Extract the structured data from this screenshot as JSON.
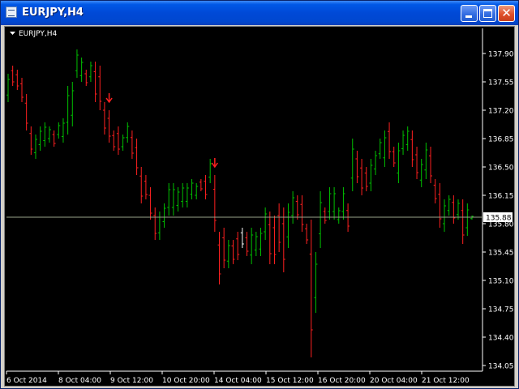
{
  "window": {
    "title": "EURJPY,H4",
    "minimize_glyph": "minimize-icon",
    "maximize_glyph": "maximize-icon",
    "close_glyph": "✕"
  },
  "chart_label": "EURJPY,H4",
  "current_price_label": "135.88",
  "colors": {
    "background": "#000000",
    "axis": "#ffffff",
    "bull": "#00c000",
    "bear": "#ff2020",
    "current_price_line": "#9aa58a",
    "current_price_box": "#ffffff",
    "arrow": "#ff2020",
    "last_bar": "#ffffff"
  },
  "chart_data": {
    "type": "ohlc-bar",
    "symbol": "EURJPY",
    "timeframe": "H4",
    "title": "EURJPY,H4",
    "ylim": [
      134.0,
      138.15
    ],
    "y_ticks": [
      "137.90",
      "137.55",
      "137.20",
      "136.85",
      "136.50",
      "136.15",
      "135.80",
      "135.45",
      "135.10",
      "134.75",
      "134.40",
      "134.05"
    ],
    "x_ticks": [
      "6 Oct 2014",
      "8 Oct 04:00",
      "9 Oct 12:00",
      "10 Oct 20:00",
      "14 Oct 04:00",
      "15 Oct 12:00",
      "16 Oct 20:00",
      "20 Oct 04:00",
      "21 Oct 12:00"
    ],
    "current_price": 135.88,
    "arrows": [
      {
        "bar_index": 22,
        "direction": "down"
      },
      {
        "bar_index": 45,
        "direction": "down"
      }
    ],
    "bars": [
      {
        "high": 137.65,
        "low": 137.3,
        "close_dir": "up"
      },
      {
        "high": 137.75,
        "low": 137.5,
        "close_dir": "down"
      },
      {
        "high": 137.7,
        "low": 137.45,
        "close_dir": "down"
      },
      {
        "high": 137.6,
        "low": 137.3,
        "close_dir": "down"
      },
      {
        "high": 137.4,
        "low": 136.95,
        "close_dir": "down"
      },
      {
        "high": 137.0,
        "low": 136.65,
        "close_dir": "down"
      },
      {
        "high": 136.9,
        "low": 136.6,
        "close_dir": "up"
      },
      {
        "high": 137.0,
        "low": 136.7,
        "close_dir": "up"
      },
      {
        "high": 137.05,
        "low": 136.75,
        "close_dir": "up"
      },
      {
        "high": 137.0,
        "low": 136.8,
        "close_dir": "up"
      },
      {
        "high": 136.95,
        "low": 136.75,
        "close_dir": "down"
      },
      {
        "high": 137.05,
        "low": 136.85,
        "close_dir": "up"
      },
      {
        "high": 137.1,
        "low": 136.8,
        "close_dir": "up"
      },
      {
        "high": 137.5,
        "low": 136.9,
        "close_dir": "up"
      },
      {
        "high": 137.55,
        "low": 137.0,
        "close_dir": "up"
      },
      {
        "high": 137.95,
        "low": 137.6,
        "close_dir": "up"
      },
      {
        "high": 137.85,
        "low": 137.55,
        "close_dir": "up"
      },
      {
        "high": 137.7,
        "low": 137.5,
        "close_dir": "down"
      },
      {
        "high": 137.8,
        "low": 137.55,
        "close_dir": "up"
      },
      {
        "high": 137.8,
        "low": 137.3,
        "close_dir": "down"
      },
      {
        "high": 137.75,
        "low": 137.2,
        "close_dir": "down"
      },
      {
        "high": 137.3,
        "low": 136.9,
        "close_dir": "down"
      },
      {
        "high": 137.2,
        "low": 136.8,
        "close_dir": "down"
      },
      {
        "high": 136.95,
        "low": 136.7,
        "close_dir": "down"
      },
      {
        "high": 137.0,
        "low": 136.65,
        "close_dir": "down"
      },
      {
        "high": 136.9,
        "low": 136.7,
        "close_dir": "up"
      },
      {
        "high": 137.05,
        "low": 136.8,
        "close_dir": "up"
      },
      {
        "high": 136.95,
        "low": 136.6,
        "close_dir": "down"
      },
      {
        "high": 136.85,
        "low": 136.4,
        "close_dir": "down"
      },
      {
        "high": 136.5,
        "low": 136.05,
        "close_dir": "down"
      },
      {
        "high": 136.4,
        "low": 136.1,
        "close_dir": "down"
      },
      {
        "high": 136.25,
        "low": 135.85,
        "close_dir": "down"
      },
      {
        "high": 136.0,
        "low": 135.6,
        "close_dir": "down"
      },
      {
        "high": 135.95,
        "low": 135.6,
        "close_dir": "up"
      },
      {
        "high": 136.05,
        "low": 135.75,
        "close_dir": "up"
      },
      {
        "high": 136.3,
        "low": 135.9,
        "close_dir": "up"
      },
      {
        "high": 136.3,
        "low": 135.9,
        "close_dir": "up"
      },
      {
        "high": 136.25,
        "low": 135.95,
        "close_dir": "up"
      },
      {
        "high": 136.3,
        "low": 136.0,
        "close_dir": "up"
      },
      {
        "high": 136.3,
        "low": 136.0,
        "close_dir": "up"
      },
      {
        "high": 136.35,
        "low": 136.1,
        "close_dir": "up"
      },
      {
        "high": 136.3,
        "low": 136.1,
        "close_dir": "up"
      },
      {
        "high": 136.35,
        "low": 136.2,
        "close_dir": "down"
      },
      {
        "high": 136.4,
        "low": 136.1,
        "close_dir": "down"
      },
      {
        "high": 136.6,
        "low": 136.3,
        "close_dir": "up"
      },
      {
        "high": 136.4,
        "low": 135.7,
        "close_dir": "down"
      },
      {
        "high": 135.7,
        "low": 135.05,
        "close_dir": "down"
      },
      {
        "high": 135.75,
        "low": 135.25,
        "close_dir": "down"
      },
      {
        "high": 135.6,
        "low": 135.25,
        "close_dir": "up"
      },
      {
        "high": 135.6,
        "low": 135.3,
        "close_dir": "down"
      },
      {
        "high": 135.7,
        "low": 135.35,
        "close_dir": "down"
      },
      {
        "high": 135.75,
        "low": 135.5,
        "close_dir": "last"
      },
      {
        "high": 135.7,
        "low": 135.4,
        "close_dir": "down"
      },
      {
        "high": 135.75,
        "low": 135.3,
        "close_dir": "up"
      },
      {
        "high": 135.7,
        "low": 135.4,
        "close_dir": "up"
      },
      {
        "high": 135.75,
        "low": 135.4,
        "close_dir": "up"
      },
      {
        "high": 136.0,
        "low": 135.6,
        "close_dir": "up"
      },
      {
        "high": 135.95,
        "low": 135.3,
        "close_dir": "down"
      },
      {
        "high": 135.9,
        "low": 135.3,
        "close_dir": "down"
      },
      {
        "high": 136.05,
        "low": 135.45,
        "close_dir": "down"
      },
      {
        "high": 136.0,
        "low": 135.2,
        "close_dir": "down"
      },
      {
        "high": 136.05,
        "low": 135.5,
        "close_dir": "up"
      },
      {
        "high": 136.2,
        "low": 135.8,
        "close_dir": "up"
      },
      {
        "high": 136.15,
        "low": 135.85,
        "close_dir": "down"
      },
      {
        "high": 136.15,
        "low": 135.7,
        "close_dir": "down"
      },
      {
        "high": 135.8,
        "low": 135.55,
        "close_dir": "down"
      },
      {
        "high": 135.85,
        "low": 134.15,
        "close_dir": "down"
      },
      {
        "high": 135.45,
        "low": 134.7,
        "close_dir": "up"
      },
      {
        "high": 136.2,
        "low": 135.5,
        "close_dir": "up"
      },
      {
        "high": 136.0,
        "low": 135.8,
        "close_dir": "down"
      },
      {
        "high": 136.25,
        "low": 135.85,
        "close_dir": "up"
      },
      {
        "high": 136.25,
        "low": 135.85,
        "close_dir": "up"
      },
      {
        "high": 136.0,
        "low": 135.8,
        "close_dir": "up"
      },
      {
        "high": 136.25,
        "low": 135.85,
        "close_dir": "up"
      },
      {
        "high": 136.05,
        "low": 135.7,
        "close_dir": "down"
      },
      {
        "high": 136.85,
        "low": 136.2,
        "close_dir": "up"
      },
      {
        "high": 136.7,
        "low": 136.3,
        "close_dir": "down"
      },
      {
        "high": 136.6,
        "low": 136.15,
        "close_dir": "down"
      },
      {
        "high": 136.5,
        "low": 136.2,
        "close_dir": "down"
      },
      {
        "high": 136.6,
        "low": 136.2,
        "close_dir": "up"
      },
      {
        "high": 136.7,
        "low": 136.4,
        "close_dir": "up"
      },
      {
        "high": 136.85,
        "low": 136.6,
        "close_dir": "up"
      },
      {
        "high": 136.95,
        "low": 136.5,
        "close_dir": "up"
      },
      {
        "high": 137.05,
        "low": 136.6,
        "close_dir": "down"
      },
      {
        "high": 136.75,
        "low": 136.5,
        "close_dir": "down"
      },
      {
        "high": 136.8,
        "low": 136.3,
        "close_dir": "up"
      },
      {
        "high": 136.95,
        "low": 136.65,
        "close_dir": "up"
      },
      {
        "high": 137.0,
        "low": 136.7,
        "close_dir": "up"
      },
      {
        "high": 136.95,
        "low": 136.5,
        "close_dir": "down"
      },
      {
        "high": 136.75,
        "low": 136.35,
        "close_dir": "down"
      },
      {
        "high": 136.6,
        "low": 136.25,
        "close_dir": "up"
      },
      {
        "high": 136.8,
        "low": 136.35,
        "close_dir": "up"
      },
      {
        "high": 136.75,
        "low": 136.3,
        "close_dir": "down"
      },
      {
        "high": 136.35,
        "low": 136.05,
        "close_dir": "down"
      },
      {
        "high": 136.3,
        "low": 135.75,
        "close_dir": "down"
      },
      {
        "high": 136.1,
        "low": 135.7,
        "close_dir": "up"
      },
      {
        "high": 136.15,
        "low": 135.9,
        "close_dir": "up"
      },
      {
        "high": 136.15,
        "low": 135.8,
        "close_dir": "down"
      },
      {
        "high": 136.1,
        "low": 135.85,
        "close_dir": "up"
      },
      {
        "high": 136.1,
        "low": 135.55,
        "close_dir": "down"
      },
      {
        "high": 136.05,
        "low": 135.65,
        "close_dir": "up"
      },
      {
        "high": 135.9,
        "low": 135.85,
        "close_dir": "up"
      }
    ]
  }
}
